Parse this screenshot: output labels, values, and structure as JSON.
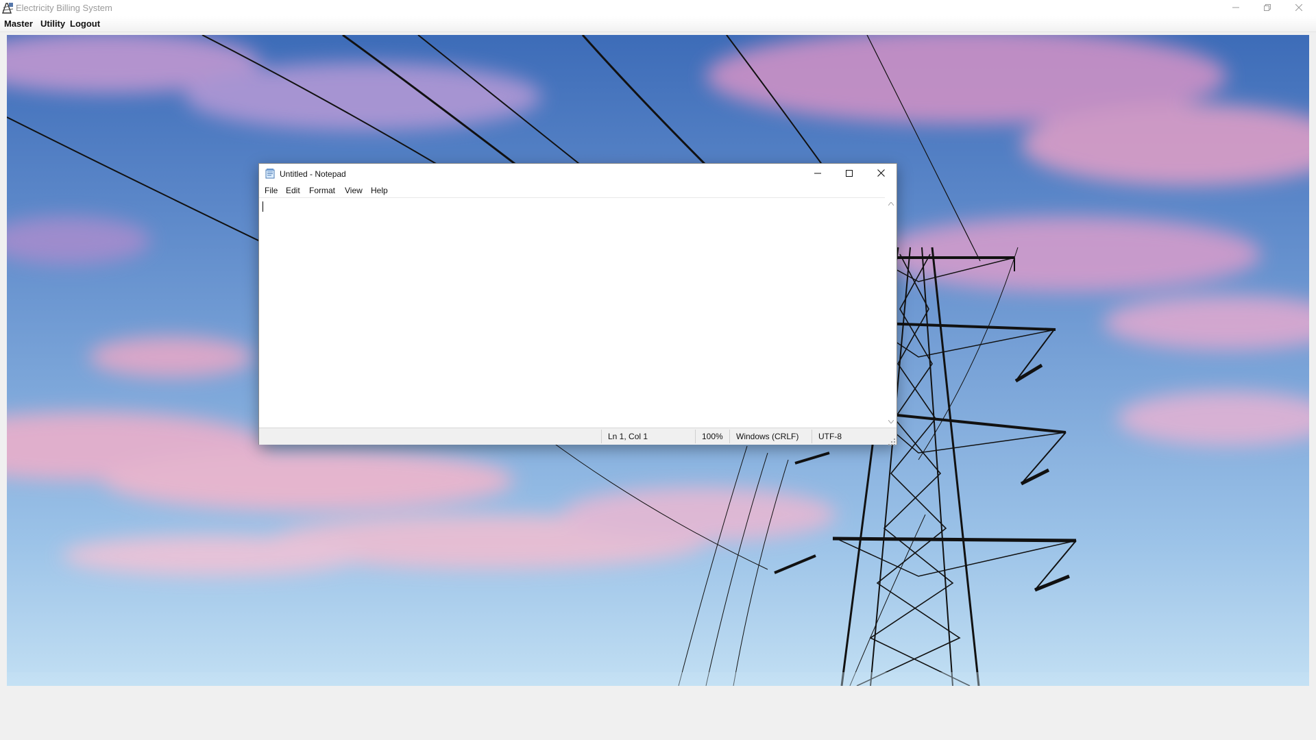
{
  "app": {
    "title": "Electricity Billing System",
    "menu": {
      "master": "Master",
      "utility": "Utility",
      "logout": "Logout"
    }
  },
  "notepad": {
    "title": "Untitled - Notepad",
    "menu": {
      "file": "File",
      "edit": "Edit",
      "format": "Format",
      "view": "View",
      "help": "Help"
    },
    "content": "",
    "status": {
      "position": "Ln 1, Col 1",
      "zoom": "100%",
      "line_ending": "Windows (CRLF)",
      "encoding": "UTF-8"
    }
  },
  "icons": {
    "app": "app-logo-icon",
    "notepad": "notepad-icon",
    "minimize": "minimize-icon",
    "maximize": "maximize-icon",
    "restore": "restore-icon",
    "close": "close-icon"
  },
  "colors": {
    "sky_top": "#3d6cb8",
    "sky_bottom": "#c2dff3",
    "cloud_pink": "#e8a2c8",
    "tower": "#111111"
  }
}
